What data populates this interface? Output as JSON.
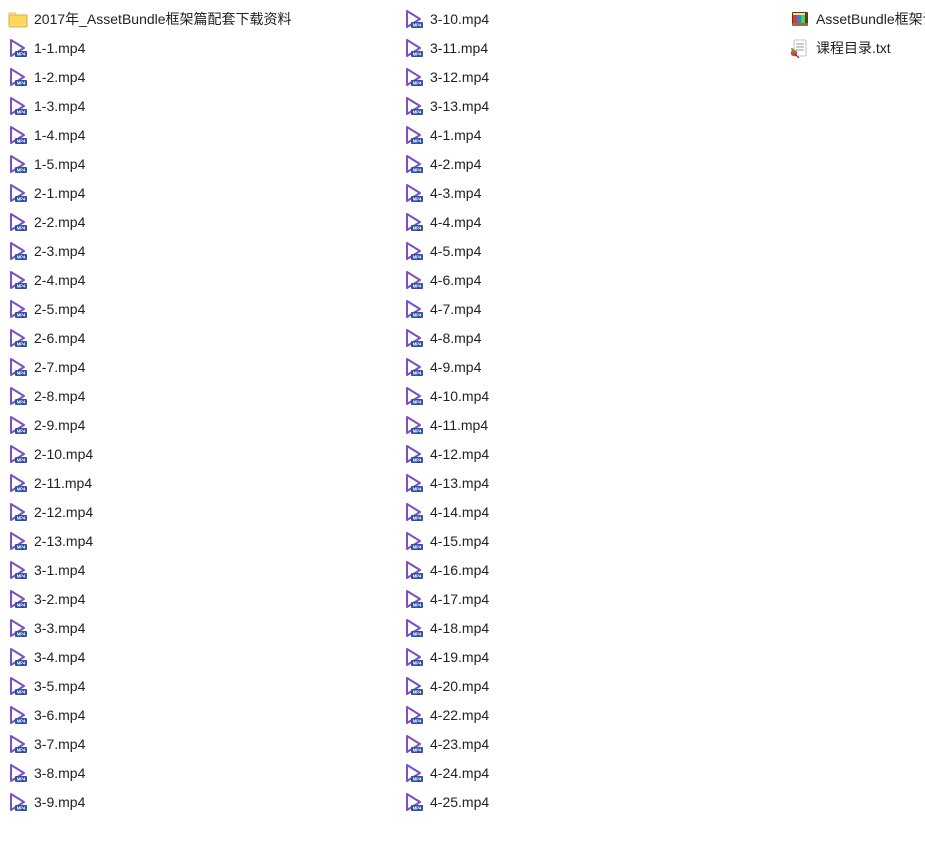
{
  "files": [
    {
      "name": "2017年_AssetBundle框架篇配套下载资料",
      "icon": "folder",
      "column": 0
    },
    {
      "name": "1-1.mp4",
      "icon": "video",
      "column": 0
    },
    {
      "name": "1-2.mp4",
      "icon": "video",
      "column": 0
    },
    {
      "name": "1-3.mp4",
      "icon": "video",
      "column": 0
    },
    {
      "name": "1-4.mp4",
      "icon": "video",
      "column": 0
    },
    {
      "name": "1-5.mp4",
      "icon": "video",
      "column": 0
    },
    {
      "name": "2-1.mp4",
      "icon": "video",
      "column": 0
    },
    {
      "name": "2-2.mp4",
      "icon": "video",
      "column": 0
    },
    {
      "name": "2-3.mp4",
      "icon": "video",
      "column": 0
    },
    {
      "name": "2-4.mp4",
      "icon": "video",
      "column": 0
    },
    {
      "name": "2-5.mp4",
      "icon": "video",
      "column": 0
    },
    {
      "name": "2-6.mp4",
      "icon": "video",
      "column": 0
    },
    {
      "name": "2-7.mp4",
      "icon": "video",
      "column": 0
    },
    {
      "name": "2-8.mp4",
      "icon": "video",
      "column": 0
    },
    {
      "name": "2-9.mp4",
      "icon": "video",
      "column": 0
    },
    {
      "name": "2-10.mp4",
      "icon": "video",
      "column": 0
    },
    {
      "name": "2-11.mp4",
      "icon": "video",
      "column": 0
    },
    {
      "name": "2-12.mp4",
      "icon": "video",
      "column": 0
    },
    {
      "name": "2-13.mp4",
      "icon": "video",
      "column": 0
    },
    {
      "name": "3-1.mp4",
      "icon": "video",
      "column": 0
    },
    {
      "name": "3-2.mp4",
      "icon": "video",
      "column": 0
    },
    {
      "name": "3-3.mp4",
      "icon": "video",
      "column": 0
    },
    {
      "name": "3-4.mp4",
      "icon": "video",
      "column": 0
    },
    {
      "name": "3-5.mp4",
      "icon": "video",
      "column": 0
    },
    {
      "name": "3-6.mp4",
      "icon": "video",
      "column": 0
    },
    {
      "name": "3-7.mp4",
      "icon": "video",
      "column": 0
    },
    {
      "name": "3-8.mp4",
      "icon": "video",
      "column": 1
    },
    {
      "name": "3-9.mp4",
      "icon": "video",
      "column": 1
    },
    {
      "name": "3-10.mp4",
      "icon": "video",
      "column": 1
    },
    {
      "name": "3-11.mp4",
      "icon": "video",
      "column": 1
    },
    {
      "name": "3-12.mp4",
      "icon": "video",
      "column": 1
    },
    {
      "name": "3-13.mp4",
      "icon": "video",
      "column": 1
    },
    {
      "name": "4-1.mp4",
      "icon": "video",
      "column": 1
    },
    {
      "name": "4-2.mp4",
      "icon": "video",
      "column": 1
    },
    {
      "name": "4-3.mp4",
      "icon": "video",
      "column": 1
    },
    {
      "name": "4-4.mp4",
      "icon": "video",
      "column": 1
    },
    {
      "name": "4-5.mp4",
      "icon": "video",
      "column": 1
    },
    {
      "name": "4-6.mp4",
      "icon": "video",
      "column": 1
    },
    {
      "name": "4-7.mp4",
      "icon": "video",
      "column": 1
    },
    {
      "name": "4-8.mp4",
      "icon": "video",
      "column": 1
    },
    {
      "name": "4-9.mp4",
      "icon": "video",
      "column": 1
    },
    {
      "name": "4-10.mp4",
      "icon": "video",
      "column": 1
    },
    {
      "name": "4-11.mp4",
      "icon": "video",
      "column": 1
    },
    {
      "name": "4-12.mp4",
      "icon": "video",
      "column": 1
    },
    {
      "name": "4-13.mp4",
      "icon": "video",
      "column": 1
    },
    {
      "name": "4-14.mp4",
      "icon": "video",
      "column": 1
    },
    {
      "name": "4-15.mp4",
      "icon": "video",
      "column": 1
    },
    {
      "name": "4-16.mp4",
      "icon": "video",
      "column": 1
    },
    {
      "name": "4-17.mp4",
      "icon": "video",
      "column": 1
    },
    {
      "name": "4-18.mp4",
      "icon": "video",
      "column": 1
    },
    {
      "name": "4-19.mp4",
      "icon": "video",
      "column": 1
    },
    {
      "name": "4-20.mp4",
      "icon": "video",
      "column": 1
    },
    {
      "name": "4-22.mp4",
      "icon": "video",
      "column": 2
    },
    {
      "name": "4-23.mp4",
      "icon": "video",
      "column": 2
    },
    {
      "name": "4-24.mp4",
      "icon": "video",
      "column": 2
    },
    {
      "name": "4-25.mp4",
      "icon": "video",
      "column": 2
    },
    {
      "name": "AssetBundle框架设计_框架篇 代码工程.zip",
      "icon": "archive",
      "column": 2
    },
    {
      "name": "课程目录.txt",
      "icon": "text",
      "column": 2
    }
  ]
}
